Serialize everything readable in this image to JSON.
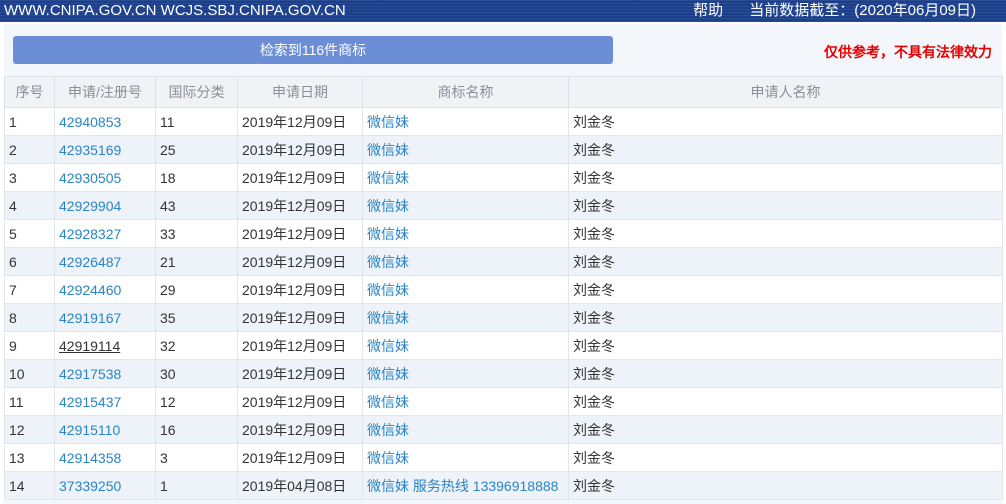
{
  "header": {
    "urls": "WWW.CNIPA.GOV.CN WCJS.SBJ.CNIPA.GOV.CN",
    "help": "帮助",
    "date_label": "当前数据截至：",
    "date_value": "(2020年06月09日)"
  },
  "result_summary": "检索到116件商标",
  "disclaimer": "仅供参考，不具有法律效力",
  "columns": [
    "序号",
    "申请/注册号",
    "国际分类",
    "申请日期",
    "商标名称",
    "申请人名称"
  ],
  "rows": [
    {
      "no": "1",
      "reg": "42940853",
      "cls": "11",
      "date": "2019年12月09日",
      "name": "微信妹",
      "applicant": "刘金冬"
    },
    {
      "no": "2",
      "reg": "42935169",
      "cls": "25",
      "date": "2019年12月09日",
      "name": "微信妹",
      "applicant": "刘金冬"
    },
    {
      "no": "3",
      "reg": "42930505",
      "cls": "18",
      "date": "2019年12月09日",
      "name": "微信妹",
      "applicant": "刘金冬"
    },
    {
      "no": "4",
      "reg": "42929904",
      "cls": "43",
      "date": "2019年12月09日",
      "name": "微信妹",
      "applicant": "刘金冬"
    },
    {
      "no": "5",
      "reg": "42928327",
      "cls": "33",
      "date": "2019年12月09日",
      "name": "微信妹",
      "applicant": "刘金冬"
    },
    {
      "no": "6",
      "reg": "42926487",
      "cls": "21",
      "date": "2019年12月09日",
      "name": "微信妹",
      "applicant": "刘金冬"
    },
    {
      "no": "7",
      "reg": "42924460",
      "cls": "29",
      "date": "2019年12月09日",
      "name": "微信妹",
      "applicant": "刘金冬"
    },
    {
      "no": "8",
      "reg": "42919167",
      "cls": "35",
      "date": "2019年12月09日",
      "name": "微信妹",
      "applicant": "刘金冬"
    },
    {
      "no": "9",
      "reg": "42919114",
      "cls": "32",
      "date": "2019年12月09日",
      "name": "微信妹",
      "applicant": "刘金冬"
    },
    {
      "no": "10",
      "reg": "42917538",
      "cls": "30",
      "date": "2019年12月09日",
      "name": "微信妹",
      "applicant": "刘金冬"
    },
    {
      "no": "11",
      "reg": "42915437",
      "cls": "12",
      "date": "2019年12月09日",
      "name": "微信妹",
      "applicant": "刘金冬"
    },
    {
      "no": "12",
      "reg": "42915110",
      "cls": "16",
      "date": "2019年12月09日",
      "name": "微信妹",
      "applicant": "刘金冬"
    },
    {
      "no": "13",
      "reg": "42914358",
      "cls": "3",
      "date": "2019年12月09日",
      "name": "微信妹",
      "applicant": "刘金冬"
    },
    {
      "no": "14",
      "reg": "37339250",
      "cls": "1",
      "date": "2019年04月08日",
      "name": "微信妹 服务热线 13396918888",
      "applicant": "刘金冬"
    }
  ],
  "colors": {
    "header_bg": "#1b3f8b",
    "result_bar": "#6b8ed6",
    "link": "#2a84c5",
    "disclaimer": "#e60000",
    "row_alt": "#eef3f9"
  }
}
